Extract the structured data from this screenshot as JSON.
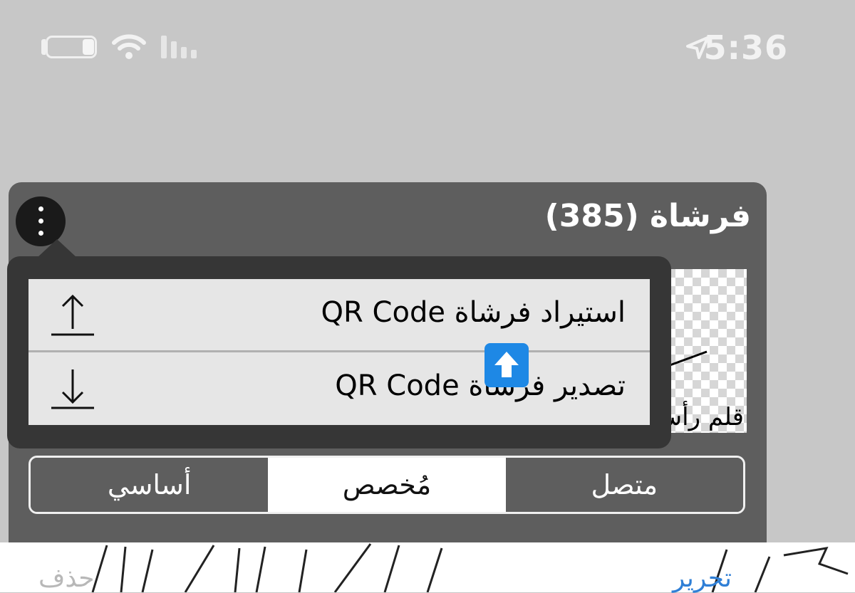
{
  "status_bar": {
    "time": "5:36",
    "battery_level": 0.15,
    "icons": [
      "battery-icon",
      "wifi-icon",
      "signal-icon",
      "location-arrow-icon"
    ]
  },
  "panel": {
    "title": "فرشاة (385)",
    "brush_name": "قلم رأس",
    "tabs": [
      {
        "label": "أساسي",
        "active": false
      },
      {
        "label": "مُخصص",
        "active": true
      },
      {
        "label": "متصل",
        "active": false
      }
    ],
    "footer": {
      "delete_label": "حذف",
      "edit_label": "تحرير"
    }
  },
  "menu": {
    "items": [
      {
        "label": "استيراد فرشاة QR Code",
        "icon": "upload-icon"
      },
      {
        "label": "تصدير فرشاة QR Code",
        "icon": "download-icon"
      }
    ]
  },
  "colors": {
    "panel": "#5e5e5e",
    "popover": "#363636",
    "menu_item": "#e6e6e6",
    "accent_blue": "#1e88e5",
    "link_blue": "#2f7fd6"
  }
}
